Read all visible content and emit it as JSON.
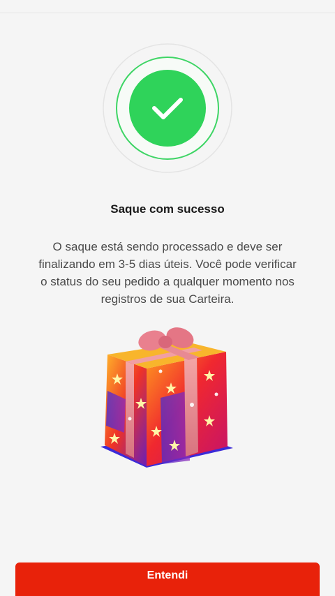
{
  "status": {
    "title": "Saque com sucesso",
    "message": "O saque está sendo processado e deve ser finalizando em 3-5 dias úteis. Você pode verificar o status do seu pedido a qualquer momento nos registros de sua Carteira."
  },
  "actions": {
    "confirm_label": "Entendi"
  },
  "colors": {
    "success_green": "#2fd35a",
    "button_red": "#e8220a"
  },
  "icons": {
    "success": "check-circle-icon",
    "reward": "gift-box-icon"
  }
}
